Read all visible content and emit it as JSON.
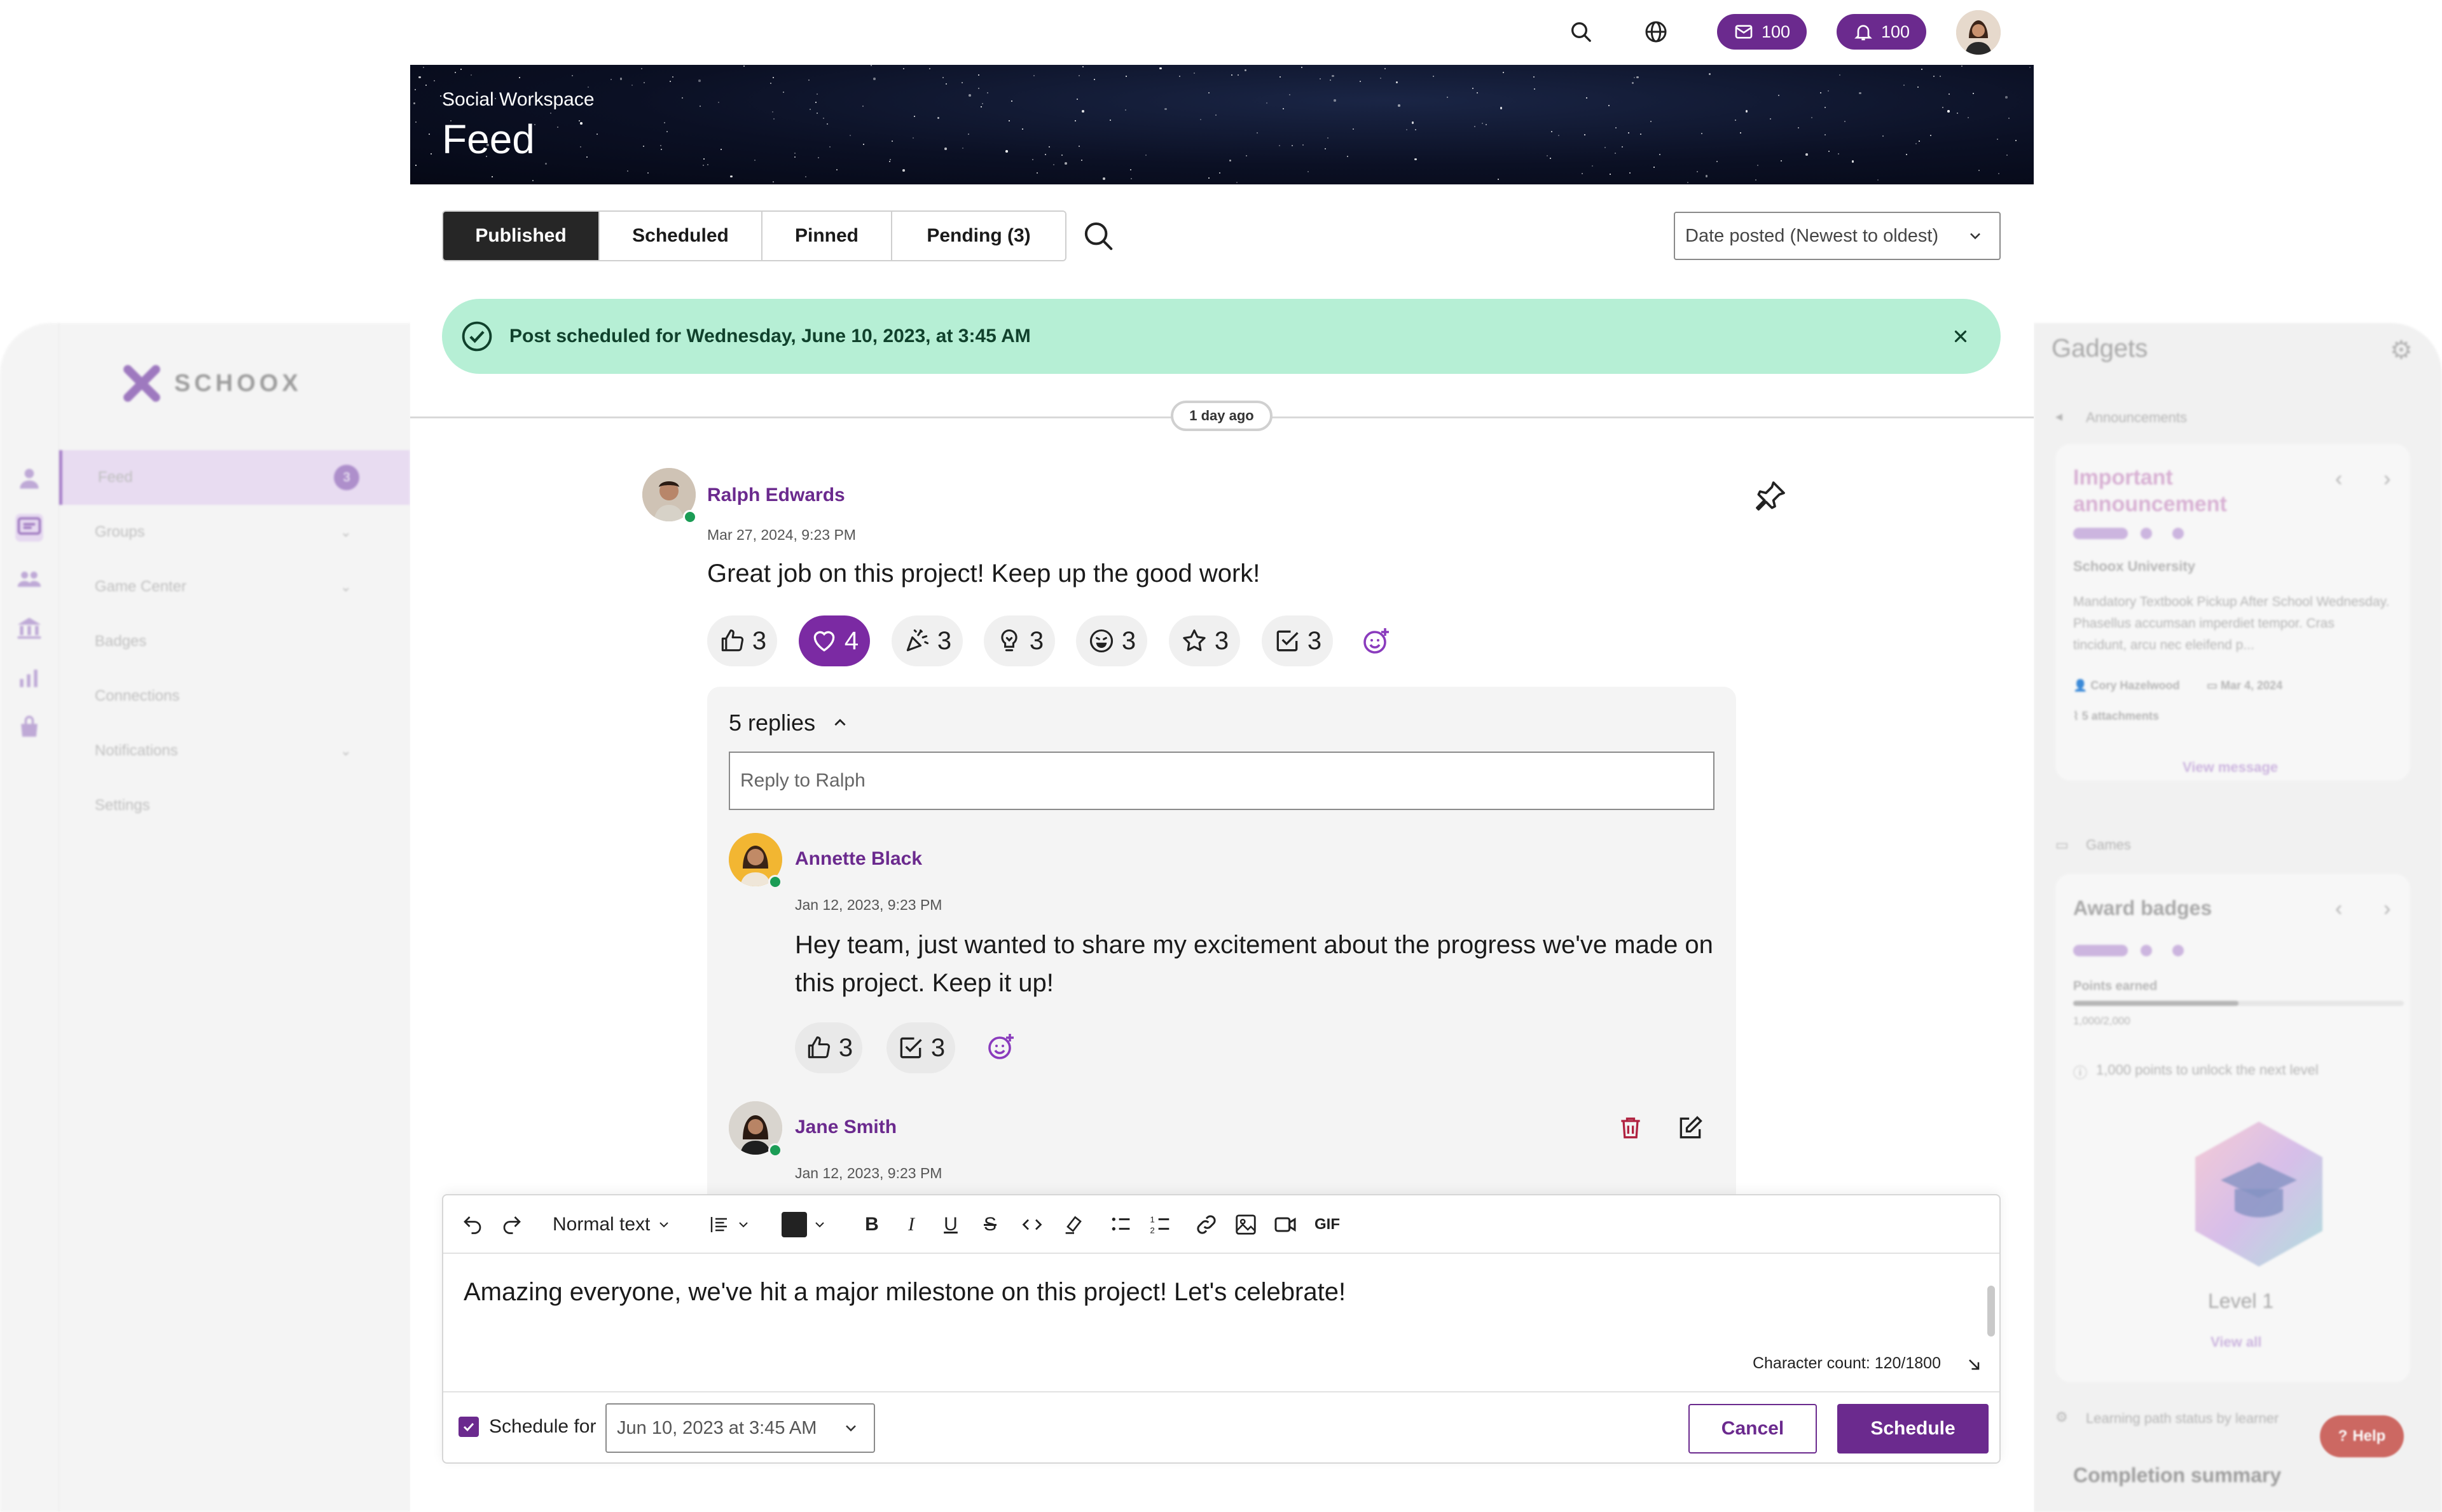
{
  "topbar": {
    "messages_count": "100",
    "notifications_count": "100"
  },
  "background_sidebar": {
    "logo_text": "SCHOOX",
    "items": [
      {
        "label": "Feed",
        "badge": "3"
      },
      {
        "label": "Groups"
      },
      {
        "label": "Game Center"
      },
      {
        "label": "Badges"
      },
      {
        "label": "Connections"
      },
      {
        "label": "Notifications"
      },
      {
        "label": "Settings"
      }
    ]
  },
  "gadgets": {
    "title": "Gadgets",
    "announcements_label": "Announcements",
    "announcement_title": "Important announcement",
    "announcement_org": "Schoox University",
    "announcement_body": "Mandatory Textbook Pickup After School Wednesday. Phasellus accumsan imperdiet tempor. Cras tincidunt, arcu nec eleifend p...",
    "announcement_author": "Cory Hazelwood",
    "announcement_date": "Mar 4, 2024",
    "announcement_attachments": "5 attachments",
    "view_message": "View message",
    "games_label": "Games",
    "award_title": "Award badges",
    "points_label": "Points earned",
    "points_value": "1,000/2,000",
    "points_fraction": 0.5,
    "points_hint": "1,000 points to unlock the next level",
    "level": "Level 1",
    "view_all": "View all",
    "learning_path_label": "Learning path status by learner",
    "completion_title": "Completion summary"
  },
  "hero": {
    "subtitle": "Social Workspace",
    "title": "Feed"
  },
  "tabs": [
    {
      "label": "Published",
      "active": true
    },
    {
      "label": "Scheduled"
    },
    {
      "label": "Pinned"
    },
    {
      "label": "Pending (3)"
    }
  ],
  "sort": {
    "value": "Date posted (Newest to oldest)"
  },
  "banner": {
    "text": "Post scheduled for Wednesday, June 10, 2023, at 3:45 AM"
  },
  "divider_label": "1 day ago",
  "post": {
    "author": "Ralph Edwards",
    "date": "Mar 27, 2024, 9:23 PM",
    "body": "Great job on this project! Keep up the good work!",
    "reactions": [
      {
        "icon": "thumbs-up-icon",
        "count": "3"
      },
      {
        "icon": "heart-icon",
        "count": "4",
        "active": true
      },
      {
        "icon": "party-popper-icon",
        "count": "3"
      },
      {
        "icon": "lightbulb-icon",
        "count": "3"
      },
      {
        "icon": "laugh-icon",
        "count": "3"
      },
      {
        "icon": "star-icon",
        "count": "3"
      },
      {
        "icon": "checkbox-icon",
        "count": "3"
      }
    ]
  },
  "replies": {
    "toggle_label": "5 replies",
    "input_placeholder": "Reply to Ralph",
    "items": [
      {
        "author": "Annette Black",
        "date": "Jan 12, 2023, 9:23 PM",
        "body_line1": "Hey team, just wanted to share my excitement about the progress we've made on",
        "body_line2": "this project. Keep it up!",
        "reactions": [
          {
            "icon": "thumbs-up-icon",
            "count": "3"
          },
          {
            "icon": "checkbox-icon",
            "count": "3"
          }
        ]
      },
      {
        "author": "Jane Smith",
        "date": "Jan 12, 2023, 9:23 PM"
      }
    ]
  },
  "composer": {
    "text_style": "Normal text",
    "gif_label": "GIF",
    "text": "Amazing everyone, we've hit a major milestone on this project! Let's celebrate!",
    "char_count": "Character count: 120/1800",
    "schedule_label": "Schedule for",
    "schedule_value": "Jun 10, 2023 at 3:45 AM",
    "cancel_label": "Cancel",
    "schedule_button": "Schedule"
  },
  "help_label": "Help",
  "colors": {
    "brand_purple": "#6b2a8e",
    "success_banner": "#b6efd5",
    "danger": "#b02240"
  }
}
